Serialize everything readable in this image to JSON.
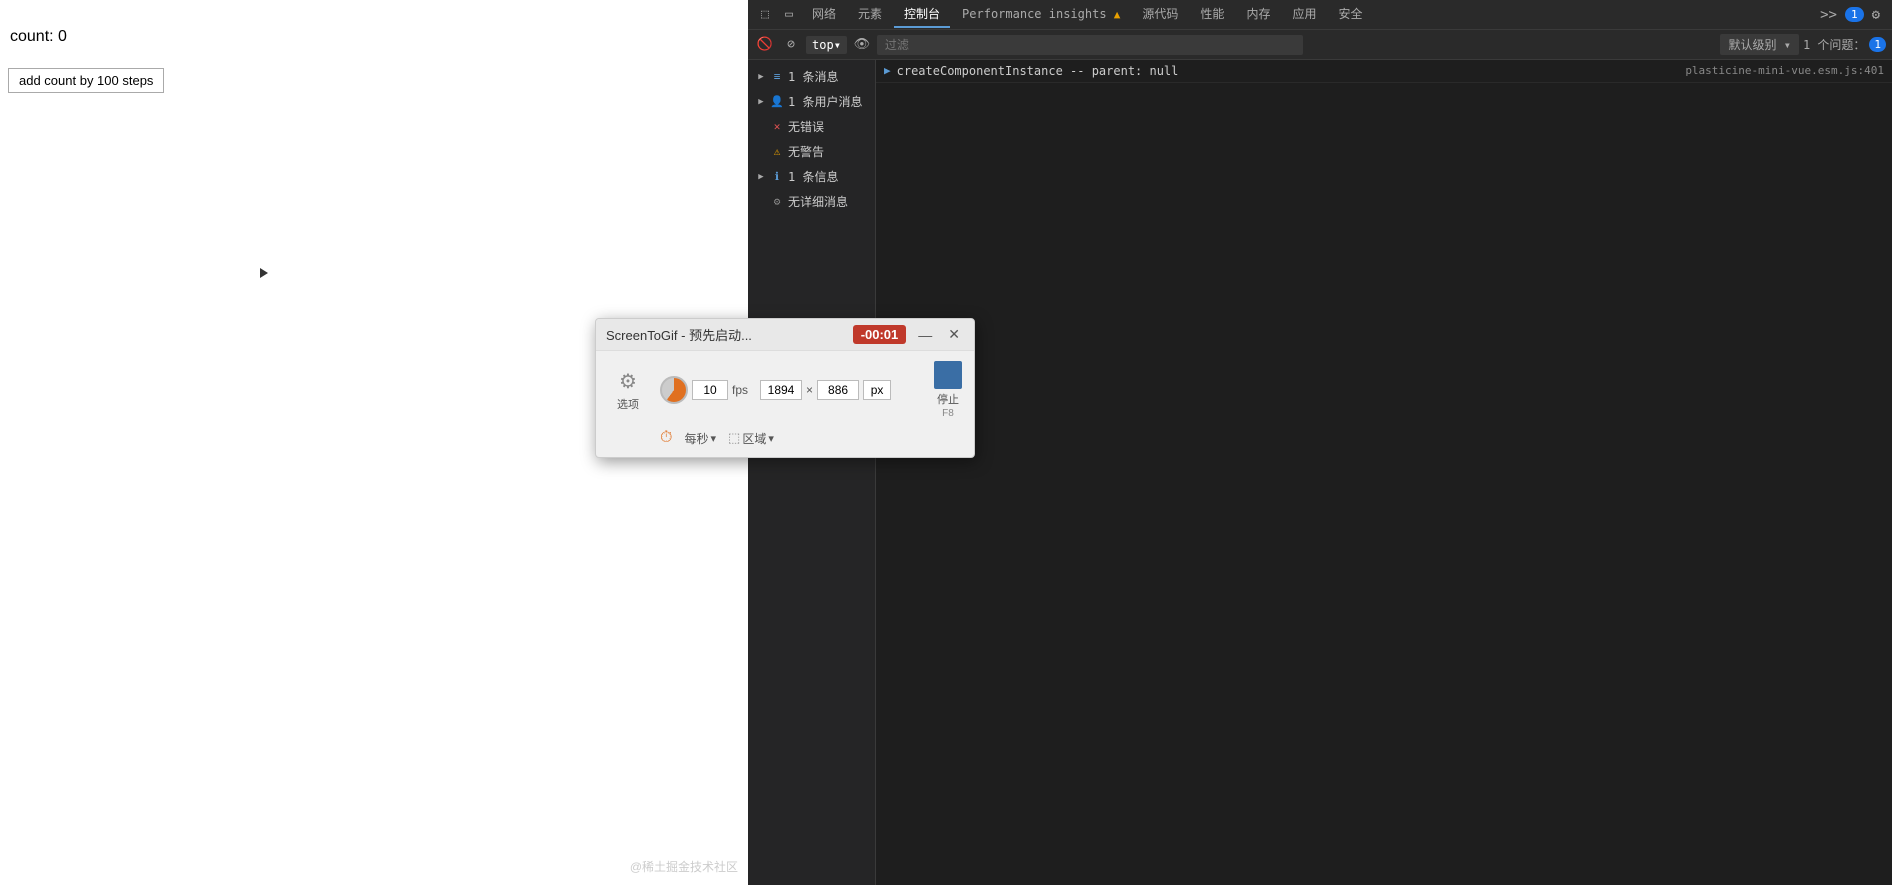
{
  "main": {
    "count_label": "count: 0",
    "add_button": "add count by 100 steps"
  },
  "watermark": "@稀土掘金技术社区",
  "devtools": {
    "tabs": [
      {
        "label": "网络",
        "active": false
      },
      {
        "label": "元素",
        "active": false
      },
      {
        "label": "控制台",
        "active": true
      },
      {
        "label": "Performance insights",
        "active": false,
        "warning": true
      },
      {
        "label": "源代码",
        "active": false
      },
      {
        "label": "性能",
        "active": false
      },
      {
        "label": "内存",
        "active": false
      },
      {
        "label": "应用",
        "active": false
      },
      {
        "label": "安全",
        "active": false
      }
    ],
    "badge_count": "1",
    "second_bar": {
      "top_dropdown": "top",
      "filter_placeholder": "过滤",
      "level_label": "默认级别",
      "issues_label": "1 个问题：",
      "issues_count": "1"
    },
    "console_tree": [
      {
        "arrow": "▶",
        "icon": "≡",
        "icon_class": "icon-info",
        "label": "1 条消息"
      },
      {
        "arrow": "▶",
        "icon": "👤",
        "icon_class": "icon-user",
        "label": "1 条用户消息"
      },
      {
        "arrow": "",
        "icon": "✕",
        "icon_class": "icon-error",
        "label": "无错误"
      },
      {
        "arrow": "",
        "icon": "⚠",
        "icon_class": "icon-warning",
        "label": "无警告"
      },
      {
        "arrow": "▶",
        "icon": "ℹ",
        "icon_class": "icon-info2",
        "label": "1 条信息"
      },
      {
        "arrow": "",
        "icon": "⚙",
        "icon_class": "icon-verbose",
        "label": "无详细消息"
      }
    ],
    "console_output": {
      "text": "createComponentInstance -- parent:  null",
      "source": "plasticine-mini-vue.esm.js:401",
      "arrow": "▶"
    }
  },
  "screentogif": {
    "title": "ScreenToGif - 预先启动...",
    "timer": "-00:01",
    "fps_value": "10",
    "fps_label": "fps",
    "width": "1894",
    "height": "886",
    "px_label": "px",
    "per_sec_label": "每秒",
    "region_label": "区域",
    "options_label": "选项",
    "stop_label": "停止",
    "stop_key": "F8"
  }
}
